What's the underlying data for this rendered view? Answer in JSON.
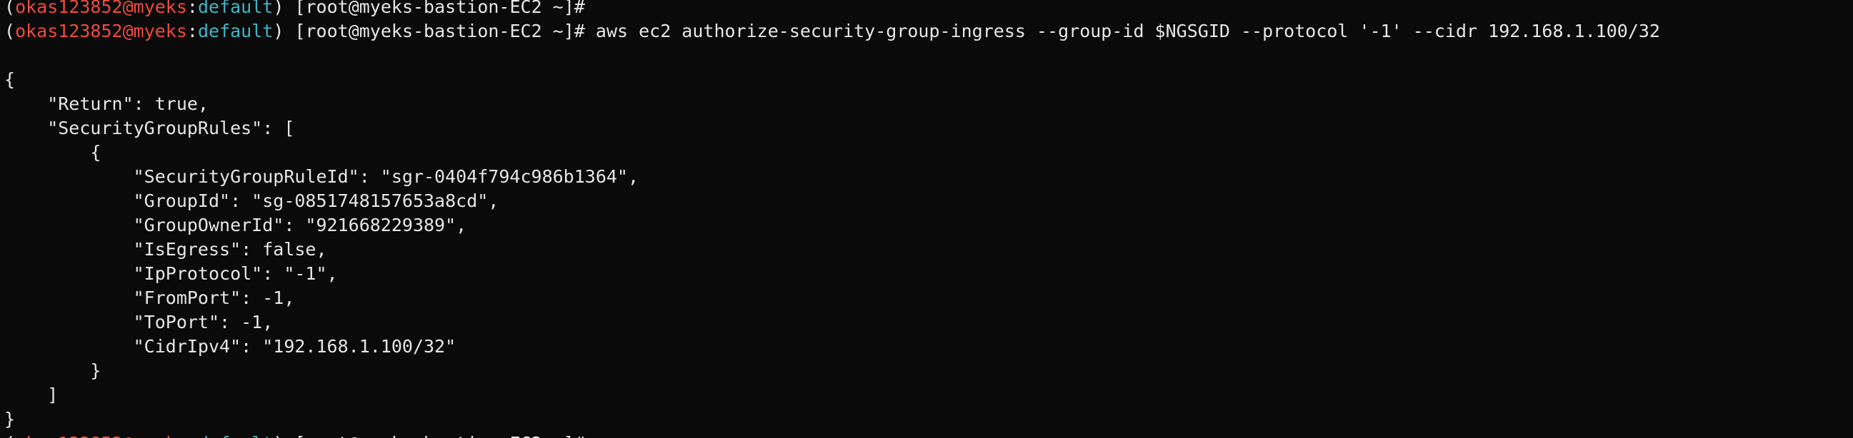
{
  "colors": {
    "background": "#0a0a0a",
    "text": "#e6e6e6",
    "user_host": "#ef4a3e",
    "profile": "#3fb6c8"
  },
  "prompt": {
    "open": "(",
    "user": "okas123852",
    "at": "@",
    "host": "myeks",
    "colon": ":",
    "profile": "default",
    "close": ")",
    "shell": " [root@myeks-bastion-EC2 ~]# "
  },
  "commands": {
    "first": "",
    "second": "aws ec2 authorize-security-group-ingress --group-id $NGSGID --protocol '-1' --cidr 192.168.1.100/32",
    "third": ""
  },
  "output": [
    "",
    "{",
    "    \"Return\": true,",
    "    \"SecurityGroupRules\": [",
    "        {",
    "            \"SecurityGroupRuleId\": \"sgr-0404f794c986b1364\",",
    "            \"GroupId\": \"sg-0851748157653a8cd\",",
    "            \"GroupOwnerId\": \"921668229389\",",
    "            \"IsEgress\": false,",
    "            \"IpProtocol\": \"-1\",",
    "            \"FromPort\": -1,",
    "            \"ToPort\": -1,",
    "            \"CidrIpv4\": \"192.168.1.100/32\"",
    "        }",
    "    ]",
    "}"
  ]
}
